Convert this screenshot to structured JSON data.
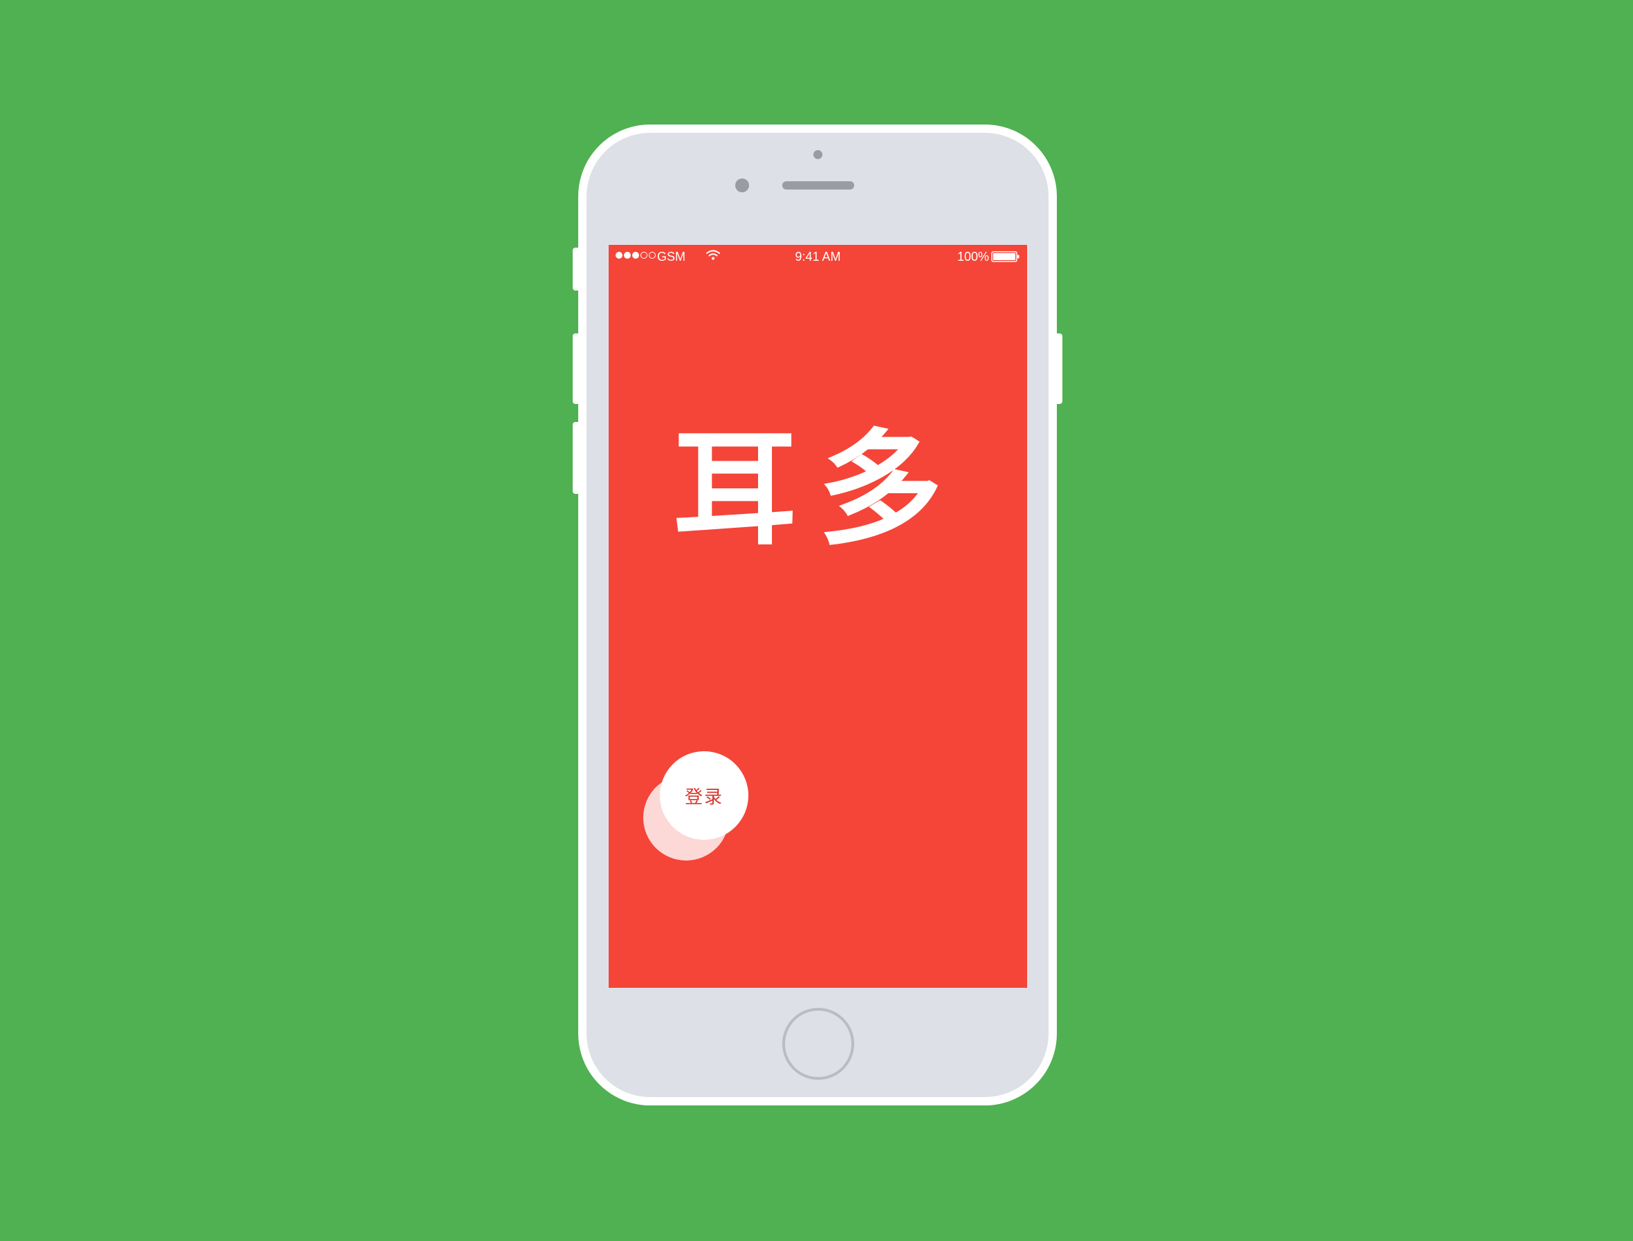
{
  "status_bar": {
    "signal_dots": 5,
    "signal_filled": 3,
    "carrier": "GSM",
    "time": "9:41 AM",
    "battery_percent": "100%",
    "battery_level": 1.0
  },
  "app": {
    "logo_text": "耳多",
    "login_label": "登录"
  },
  "colors": {
    "background": "#4fb151",
    "phone_body": "#dde0e7",
    "screen": "#f44538",
    "login_text": "#d7352b"
  },
  "icons": {
    "wifi": "wifi-icon",
    "battery": "battery-icon"
  }
}
